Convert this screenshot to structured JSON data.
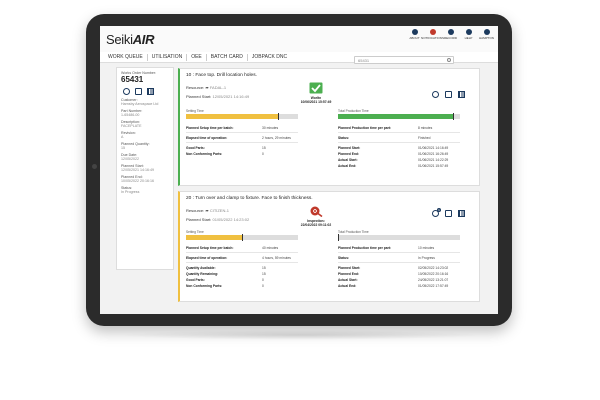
{
  "app": {
    "logo_prefix": "Seiki",
    "logo_suffix": "AIR"
  },
  "top_icons": [
    {
      "name": "about-icon",
      "label": "ABOUT",
      "red": false
    },
    {
      "name": "notifications-icon",
      "label": "NOTIFICATIONS",
      "red": true
    },
    {
      "name": "record-icon",
      "label": "RECORD",
      "red": false
    },
    {
      "name": "help-icon",
      "label": "HELP",
      "red": false
    },
    {
      "name": "user-icon",
      "label": "HAMPTON",
      "red": false
    }
  ],
  "nav": {
    "tabs": [
      "WORK QUEUE",
      "UTILISATION",
      "OEE",
      "BATCH CARD",
      "JOBPACK DNC"
    ]
  },
  "search": {
    "placeholder": "65431"
  },
  "info": {
    "work_order_label": "Works Order Number:",
    "work_order": "65431",
    "customer_label": "Customer:",
    "customer": "Harnsby Aerospace Ltd",
    "part_label": "Part Number:",
    "part": "1-65486-00",
    "desc_label": "Description:",
    "desc": "FACEPLATE",
    "rev_label": "Revision:",
    "rev": "A",
    "qty_label": "Planned Quantity:",
    "qty": "15",
    "due_label": "Due Date:",
    "due": "12/05/2022",
    "start_label": "Planned Start:",
    "start": "12/05/2021 14:16:49",
    "end_label": "Planned End:",
    "end": "10/05/2022 20:16:16",
    "status_label": "Status:",
    "status": "In Progress"
  },
  "op1": {
    "title": "10 : Face top. Drill location holes.",
    "resource_label": "Resource:",
    "resource": "FADAL-1",
    "planned_start_label": "Planned Start:",
    "planned_start": "12/05/2021 14:16:49",
    "status_name": "Worltn",
    "status_time": "10/06/2021 15:57:49",
    "setting_time_label": "Setting Time",
    "production_time_label": "Total Production Time",
    "setting_fill": 0.82,
    "production_fill": 0.94,
    "left": [
      {
        "k": "Planned Setup time per batch:",
        "v": "30 minutes"
      },
      {
        "k": "Elapsed time of operation:",
        "v": "2 hours, 29 minutes"
      },
      {
        "k": "Good Parts:",
        "v": "15"
      },
      {
        "k": "Non Conforming Parts:",
        "v": "0"
      }
    ],
    "right": [
      {
        "k": "Planned Production time per part:",
        "v": "8 minutes"
      },
      {
        "k": "Status:",
        "v": "Finished"
      },
      {
        "k": "Planned Start:",
        "v": "01/06/2021 14:16:49"
      },
      {
        "k": "Planned End:",
        "v": "01/06/2021 16:26:49"
      },
      {
        "k": "Actual Start:",
        "v": "01/06/2021 14:22:29"
      },
      {
        "k": "Actual End:",
        "v": "01/06/2021 15:57:49"
      }
    ],
    "colors": {
      "setting": "#f0c040",
      "production": "#4caf50"
    }
  },
  "op2": {
    "title": "20 : Turn over and clamp to fixture. Face to finish thickness.",
    "resource_label": "Resource:",
    "resource": "CITIZEN-1",
    "planned_start_label": "Planned Start:",
    "planned_start": "01/05/2022 14:23:02",
    "status_name": "Inspection:",
    "status_time": "22/04/2022 09:11:02",
    "badge_count": "1",
    "setting_time_label": "Setting Time",
    "production_time_label": "Total Production Time",
    "setting_fill": 0.5,
    "production_fill": 0.0,
    "left": [
      {
        "k": "Planned Setup time per batch:",
        "v": "40 minutes"
      },
      {
        "k": "Elapsed time of operation:",
        "v": "4 hours, 59 minutes"
      },
      {
        "k": "Quantity Available:",
        "v": "15"
      },
      {
        "k": "Quantity Remaining:",
        "v": "15"
      },
      {
        "k": "Good Parts:",
        "v": "0"
      },
      {
        "k": "Non Conforming Parts:",
        "v": "0"
      }
    ],
    "right": [
      {
        "k": "Planned Production time per part:",
        "v": "10 minutes"
      },
      {
        "k": "Status:",
        "v": "In Progress"
      },
      {
        "k": "Planned Start:",
        "v": "02/05/2022 14:23:02"
      },
      {
        "k": "Planned End:",
        "v": "10/05/2022 20:16:16"
      },
      {
        "k": "Actual Start:",
        "v": "24/05/2022 13:21:07"
      },
      {
        "k": "Actual End:",
        "v": "01/05/2022 17:57:49"
      }
    ],
    "colors": {
      "setting": "#f0c040",
      "production": "#bbbbbb"
    }
  }
}
